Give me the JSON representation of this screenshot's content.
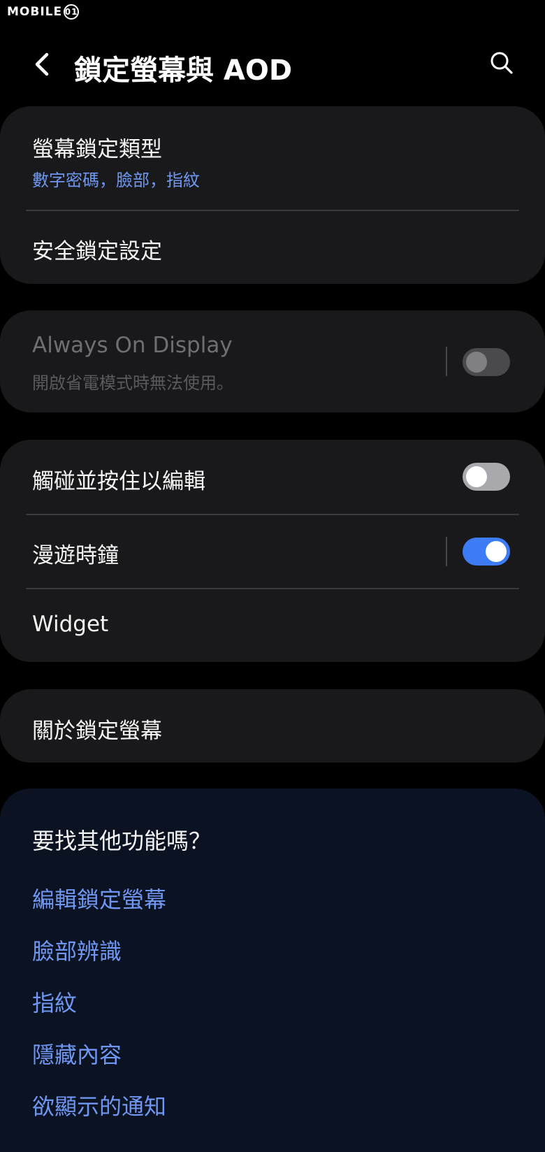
{
  "watermark": {
    "text": "MOBILE",
    "badge": "01"
  },
  "header": {
    "title": "鎖定螢幕與 AOD",
    "back_icon": "chevron-left-icon",
    "search_icon": "search-icon"
  },
  "lock_section": {
    "items": [
      {
        "title": "螢幕鎖定類型",
        "subtitle": "數字密碼，臉部，指紋"
      },
      {
        "title": "安全鎖定設定"
      }
    ]
  },
  "aod_section": {
    "title": "Always On Display",
    "subtitle": "開啟省電模式時無法使用。",
    "toggle_state": "off",
    "enabled": false
  },
  "edit_section": {
    "items": [
      {
        "title": "觸碰並按住以編輯",
        "toggle_state": "off"
      },
      {
        "title": "漫遊時鐘",
        "toggle_state": "on"
      },
      {
        "title": "Widget"
      }
    ]
  },
  "about_section": {
    "title": "關於鎖定螢幕"
  },
  "suggestions": {
    "title": "要找其他功能嗎？",
    "links": [
      "編輯鎖定螢幕",
      "臉部辨識",
      "指紋",
      "隱藏內容",
      "欲顯示的通知"
    ]
  },
  "colors": {
    "background": "#000000",
    "card": "#19191b",
    "suggest_card": "#0b1222",
    "accent": "#3e7cf5",
    "link": "#6f97f2"
  }
}
